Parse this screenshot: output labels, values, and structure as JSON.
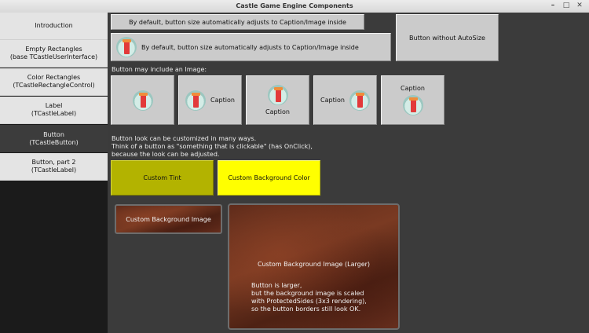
{
  "window": {
    "title": "Castle Game Engine Components",
    "controls": {
      "minimize": "–",
      "maximize": "□",
      "close": "✕"
    }
  },
  "sidebar": {
    "items": [
      {
        "lines": [
          "Introduction"
        ],
        "active": false
      },
      {
        "lines": [
          "Empty Rectangles",
          "(base TCastleUserInterface)"
        ],
        "active": false
      },
      {
        "lines": [
          "Color Rectangles",
          "(TCastleRectangleControl)"
        ],
        "active": false
      },
      {
        "lines": [
          "Label",
          "(TCastleLabel)"
        ],
        "active": false
      },
      {
        "lines": [
          "Button",
          "(TCastleButton)"
        ],
        "active": true
      },
      {
        "lines": [
          "Button, part 2",
          "(TCastleLabel)"
        ],
        "active": false
      }
    ]
  },
  "main": {
    "autosize_button": "By default, button size automatically adjusts to Caption/Image inside",
    "autosize_image_button": "By default, button size automatically adjusts to Caption/Image inside",
    "no_autosize_button": "Button without AutoSize",
    "image_label": "Button may include an Image:",
    "image_buttons": {
      "caption": "Caption"
    },
    "customize_text": [
      "Button look can be customized in many ways.",
      "Think of a button as \"something that is clickable\" (has OnClick),",
      "because the look can be adjusted."
    ],
    "custom_tint": "Custom Tint",
    "custom_bg_color": "Custom Background Color",
    "custom_bg_image": "Custom Background Image",
    "custom_bg_image_large": {
      "caption": "Custom Background Image (Larger)",
      "lines": [
        "Button is larger,",
        "but the background image is scaled",
        "with ProtectedSides (3x3 rendering),",
        "so the button borders still look OK."
      ]
    }
  },
  "colors": {
    "tint": "#b3b300",
    "background_color": "#ffff00",
    "sidebar_active": "#3c3c3c"
  },
  "icons": {
    "button_image": "castle-tower-icon"
  }
}
